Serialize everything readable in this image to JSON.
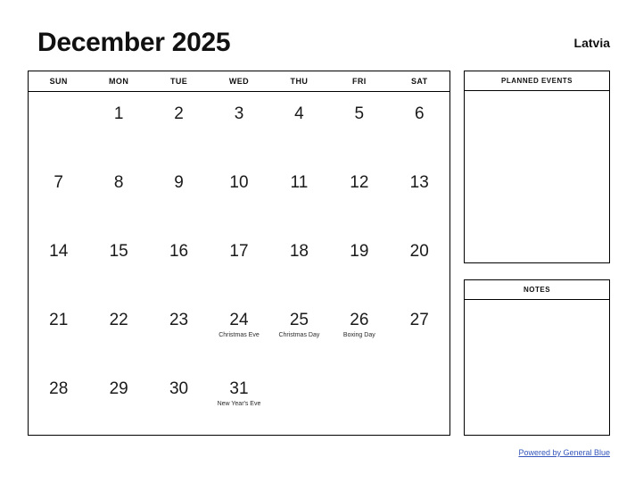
{
  "header": {
    "title": "December 2025",
    "country": "Latvia"
  },
  "calendar": {
    "weekdays": [
      "SUN",
      "MON",
      "TUE",
      "WED",
      "THU",
      "FRI",
      "SAT"
    ],
    "weeks": [
      [
        {
          "day": "",
          "event": ""
        },
        {
          "day": "1",
          "event": ""
        },
        {
          "day": "2",
          "event": ""
        },
        {
          "day": "3",
          "event": ""
        },
        {
          "day": "4",
          "event": ""
        },
        {
          "day": "5",
          "event": ""
        },
        {
          "day": "6",
          "event": ""
        }
      ],
      [
        {
          "day": "7",
          "event": ""
        },
        {
          "day": "8",
          "event": ""
        },
        {
          "day": "9",
          "event": ""
        },
        {
          "day": "10",
          "event": ""
        },
        {
          "day": "11",
          "event": ""
        },
        {
          "day": "12",
          "event": ""
        },
        {
          "day": "13",
          "event": ""
        }
      ],
      [
        {
          "day": "14",
          "event": ""
        },
        {
          "day": "15",
          "event": ""
        },
        {
          "day": "16",
          "event": ""
        },
        {
          "day": "17",
          "event": ""
        },
        {
          "day": "18",
          "event": ""
        },
        {
          "day": "19",
          "event": ""
        },
        {
          "day": "20",
          "event": ""
        }
      ],
      [
        {
          "day": "21",
          "event": ""
        },
        {
          "day": "22",
          "event": ""
        },
        {
          "day": "23",
          "event": ""
        },
        {
          "day": "24",
          "event": "Christmas Eve"
        },
        {
          "day": "25",
          "event": "Christmas Day"
        },
        {
          "day": "26",
          "event": "Boxing Day"
        },
        {
          "day": "27",
          "event": ""
        }
      ],
      [
        {
          "day": "28",
          "event": ""
        },
        {
          "day": "29",
          "event": ""
        },
        {
          "day": "30",
          "event": ""
        },
        {
          "day": "31",
          "event": "New Year's Eve"
        },
        {
          "day": "",
          "event": ""
        },
        {
          "day": "",
          "event": ""
        },
        {
          "day": "",
          "event": ""
        }
      ]
    ]
  },
  "panels": {
    "planned_events": {
      "title": "PLANNED EVENTS",
      "content": ""
    },
    "notes": {
      "title": "NOTES",
      "content": ""
    }
  },
  "footer": {
    "link_text": "Powered by General Blue",
    "link_color": "#3355bb"
  }
}
